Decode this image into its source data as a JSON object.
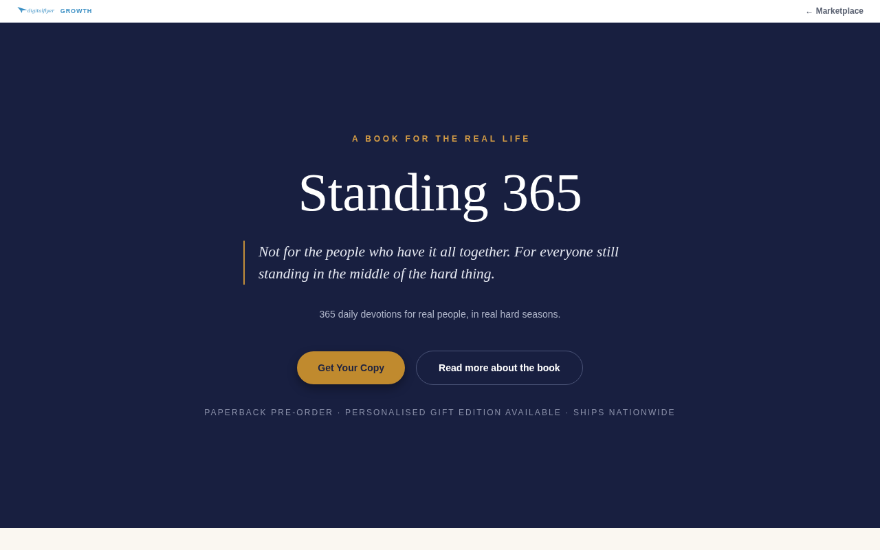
{
  "header": {
    "logo": {
      "brand": "digitalflyer",
      "label": "GROWTH"
    },
    "back_link": {
      "arrow": "←",
      "label": "Marketplace"
    }
  },
  "hero": {
    "eyebrow": "A BOOK FOR THE REAL LIFE",
    "title": "Standing 365",
    "quote": "Not for the people who have it all together. For everyone still standing in the middle of the hard thing.",
    "subtitle": "365 daily devotions for real people, in real hard seasons.",
    "buttons": [
      {
        "label": "Get Your Copy",
        "kind": "primary"
      },
      {
        "label": "Read more about the book",
        "kind": "secondary"
      }
    ],
    "note": "PAPERBACK PRE-ORDER · PERSONALISED GIFT EDITION AVAILABLE · SHIPS NATIONWIDE"
  }
}
